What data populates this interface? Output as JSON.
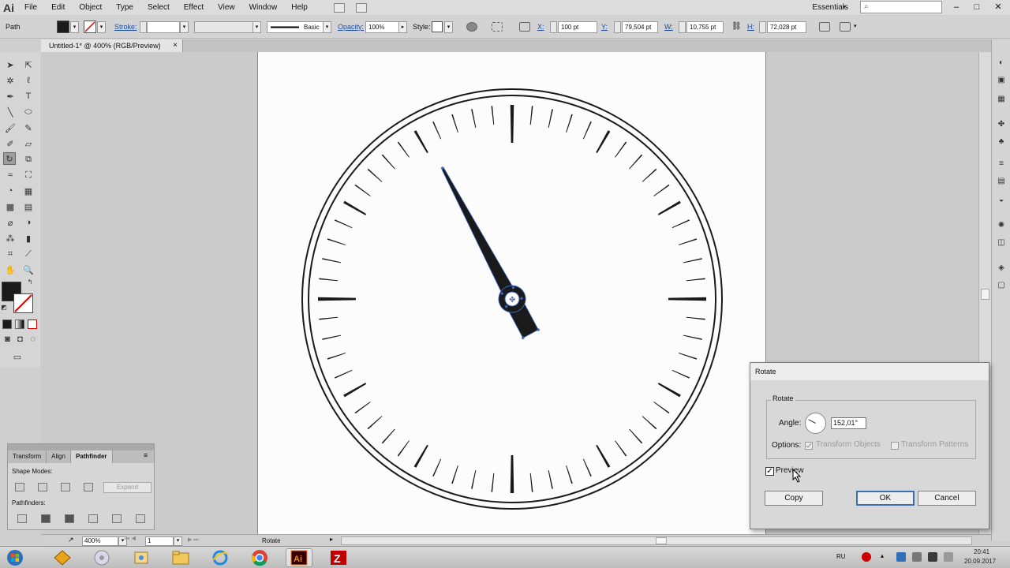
{
  "app": {
    "logo": "Ai",
    "workspace": "Essentials",
    "window_controls": [
      "–",
      "□",
      "✕"
    ]
  },
  "menu": [
    "File",
    "Edit",
    "Object",
    "Type",
    "Select",
    "Effect",
    "View",
    "Window",
    "Help"
  ],
  "control_bar": {
    "selection_type": "Path",
    "stroke_label": "Stroke:",
    "brush_profile": "Basic",
    "opacity_label": "Opacity:",
    "opacity_value": "100%",
    "style_label": "Style:",
    "x_label": "X:",
    "x_value": "100 pt",
    "y_label": "Y:",
    "y_value": "79,504 pt",
    "w_label": "W:",
    "w_value": "10,755 pt",
    "h_label": "H:",
    "h_value": "72,028 pt"
  },
  "document_tab": {
    "title": "Untitled-1* @ 400% (RGB/Preview)",
    "close": "×"
  },
  "status_bar": {
    "zoom": "400%",
    "page": "1",
    "status": "Rotate"
  },
  "pathfinder_panel": {
    "tabs": [
      "Transform",
      "Align",
      "Pathfinder"
    ],
    "shape_modes_label": "Shape Modes:",
    "expand_label": "Expand",
    "pathfinders_label": "Pathfinders:"
  },
  "rotate_dialog": {
    "title": "Rotate",
    "group_label": "Rotate",
    "angle_label": "Angle:",
    "angle_value": "152,01°",
    "angle_degrees": 152.01,
    "options_label": "Options:",
    "transform_objects": "Transform Objects",
    "transform_patterns": "Transform Patterns",
    "preview_label": "Preview",
    "preview_checked": true,
    "copy_label": "Copy",
    "ok_label": "OK",
    "cancel_label": "Cancel"
  },
  "artwork": {
    "tick_count": 60,
    "hand_angle_deg": 152.01,
    "fill_color": "#1a1a1a",
    "selection_color": "#3a66c4"
  },
  "taskbar": {
    "language": "RU",
    "time": "20:41",
    "date": "20.09.2017"
  },
  "colors": {
    "accent": "#3a6fb3",
    "link": "#1d4fa0"
  }
}
